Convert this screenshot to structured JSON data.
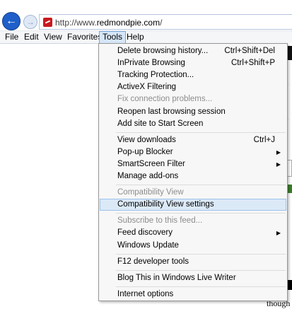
{
  "browser": {
    "url_prefix": "http://www.",
    "url_domain": "redmondpie.com",
    "url_suffix": "/"
  },
  "menubar": {
    "items": [
      "File",
      "Edit",
      "View",
      "Favorites",
      "Tools",
      "Help"
    ],
    "active": "Tools"
  },
  "tools_menu": {
    "items": [
      {
        "label": "Delete browsing history...",
        "shortcut": "Ctrl+Shift+Del",
        "enabled": true
      },
      {
        "label": "InPrivate Browsing",
        "shortcut": "Ctrl+Shift+P",
        "enabled": true
      },
      {
        "label": "Tracking Protection...",
        "shortcut": "",
        "enabled": true
      },
      {
        "label": "ActiveX Filtering",
        "shortcut": "",
        "enabled": true
      },
      {
        "label": "Fix connection problems...",
        "shortcut": "",
        "enabled": false
      },
      {
        "label": "Reopen last browsing session",
        "shortcut": "",
        "enabled": true
      },
      {
        "label": "Add site to Start Screen",
        "shortcut": "",
        "enabled": true
      },
      {
        "label": "View downloads",
        "shortcut": "Ctrl+J",
        "enabled": true
      },
      {
        "label": "Pop-up Blocker",
        "shortcut": "",
        "enabled": true,
        "submenu": true
      },
      {
        "label": "SmartScreen Filter",
        "shortcut": "",
        "enabled": true,
        "submenu": true
      },
      {
        "label": "Manage add-ons",
        "shortcut": "",
        "enabled": true
      },
      {
        "label": "Compatibility View",
        "shortcut": "",
        "enabled": false
      },
      {
        "label": "Compatibility View settings",
        "shortcut": "",
        "enabled": true,
        "highlighted": true
      },
      {
        "label": "Subscribe to this feed...",
        "shortcut": "",
        "enabled": false
      },
      {
        "label": "Feed discovery",
        "shortcut": "",
        "enabled": true,
        "submenu": true
      },
      {
        "label": "Windows Update",
        "shortcut": "",
        "enabled": true
      },
      {
        "label": "F12 developer tools",
        "shortcut": "",
        "enabled": true
      },
      {
        "label": "Blog This in Windows Live Writer",
        "shortcut": "",
        "enabled": true
      },
      {
        "label": "Internet options",
        "shortcut": "",
        "enabled": true
      }
    ]
  },
  "page_fragments": {
    "bottom_right_text": "though"
  },
  "colors": {
    "accent": "#1e5fc9",
    "highlight_bg": "#dbe9f7",
    "disabled_text": "#8d8d8d",
    "brand_red": "#c9191f"
  }
}
